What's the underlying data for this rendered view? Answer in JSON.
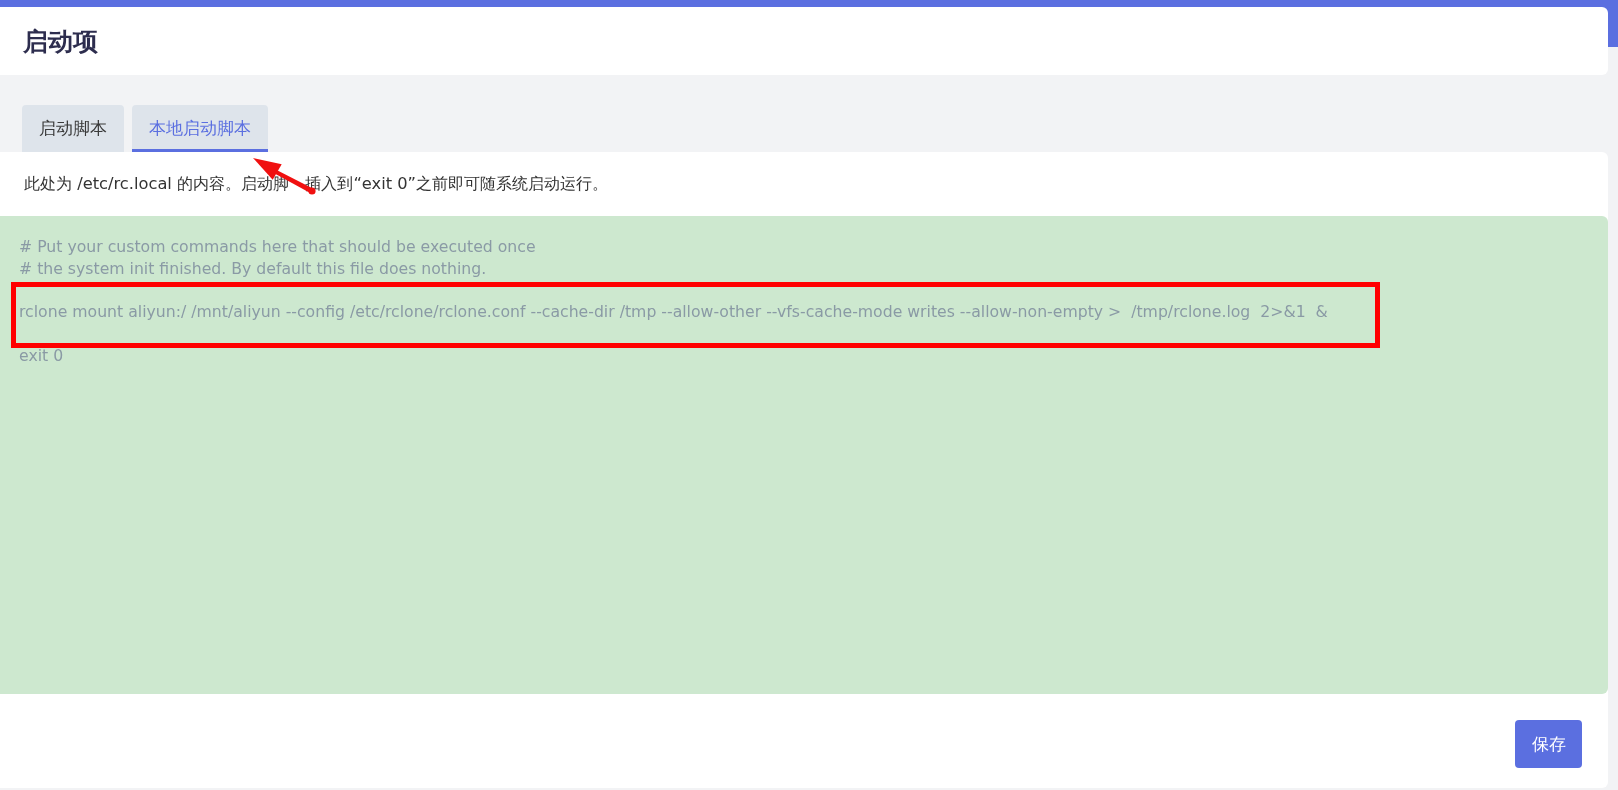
{
  "page": {
    "title": "启动项"
  },
  "tabs": [
    {
      "label": "启动脚本",
      "selected": false
    },
    {
      "label": "本地启动脚本",
      "selected": true
    }
  ],
  "description": [
    "此处为 /etc/rc.local 的内容。启动脚",
    "插入到“exit 0”之前即可随系统启动运行。"
  ],
  "editor": {
    "value": "# Put your custom commands here that should be executed once\n# the system init finished. By default this file does nothing.\n\nrclone mount aliyun:/ /mnt/aliyun --config /etc/rclone/rclone.conf --cache-dir /tmp --allow-other --vfs-cache-mode writes --allow-non-empty >  /tmp/rclone.log  2>&1  &\n\nexit 0"
  },
  "buttons": [
    {
      "label": "保存"
    }
  ],
  "annotations": {
    "highlight_box": true,
    "arrow": true
  }
}
